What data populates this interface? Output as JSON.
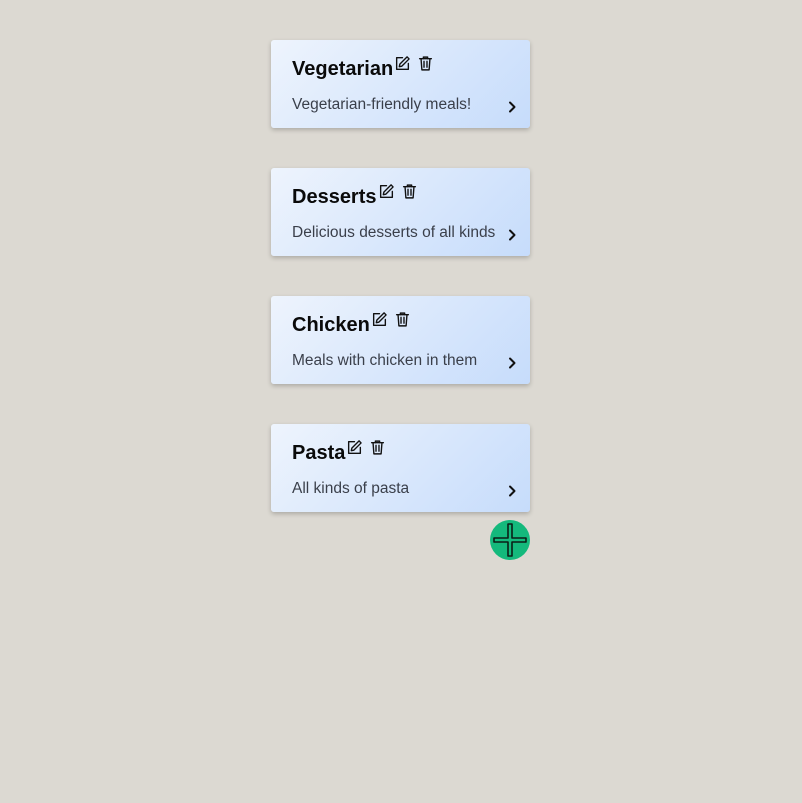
{
  "categories": [
    {
      "title": "Vegetarian",
      "description": "Vegetarian-friendly meals!"
    },
    {
      "title": "Desserts",
      "description": "Delicious desserts of all kinds"
    },
    {
      "title": "Chicken",
      "description": "Meals with chicken in them"
    },
    {
      "title": "Pasta",
      "description": "All kinds of pasta"
    }
  ],
  "icons": {
    "edit": "edit-icon",
    "delete": "trash-icon",
    "open": "chevron-right-icon",
    "add": "plus-icon"
  },
  "colors": {
    "background": "#dcd9d2",
    "card_gradient_start": "#eef4fd",
    "card_gradient_end": "#c6dcfb",
    "add_button": "#14b97c"
  }
}
